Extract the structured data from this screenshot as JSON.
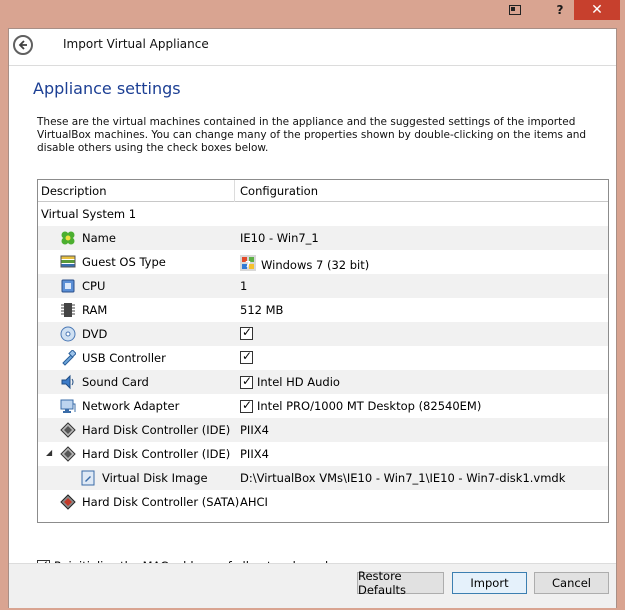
{
  "window": {
    "title": "Import Virtual Appliance",
    "help_glyph": "?",
    "close_glyph": "✕"
  },
  "page": {
    "heading": "Appliance settings",
    "description": "These are the virtual machines contained in the appliance and the suggested settings of the imported VirtualBox machines. You can change many of the properties shown by double-clicking on the items and disable others using the check boxes below."
  },
  "table": {
    "columns": [
      "Description",
      "Configuration"
    ],
    "system_label": "Virtual System 1",
    "rows": [
      {
        "label": "Name",
        "value": "IE10 - Win7_1",
        "icon": "name-icon",
        "checkbox": false
      },
      {
        "label": "Guest OS Type",
        "value": "Windows 7 (32 bit)",
        "icon": "os-type-icon",
        "checkbox": false
      },
      {
        "label": "CPU",
        "value": "1",
        "icon": "cpu-icon",
        "checkbox": false
      },
      {
        "label": "RAM",
        "value": "512 MB",
        "icon": "ram-icon",
        "checkbox": false
      },
      {
        "label": "DVD",
        "value": "",
        "icon": "dvd-icon",
        "checkbox": true
      },
      {
        "label": "USB Controller",
        "value": "",
        "icon": "usb-icon",
        "checkbox": true
      },
      {
        "label": "Sound Card",
        "value": "Intel HD Audio",
        "icon": "sound-card-icon",
        "checkbox": true
      },
      {
        "label": "Network Adapter",
        "value": "Intel PRO/1000 MT Desktop (82540EM)",
        "icon": "network-adapter-icon",
        "checkbox": true
      },
      {
        "label": "Hard Disk Controller (IDE)",
        "value": "PIIX4",
        "icon": "hdd-controller-icon",
        "checkbox": false
      },
      {
        "label": "Hard Disk Controller (IDE)",
        "value": "PIIX4",
        "icon": "hdd-controller-icon",
        "checkbox": false
      },
      {
        "label": "Virtual Disk Image",
        "value": "D:\\VirtualBox VMs\\IE10 - Win7_1\\IE10 - Win7-disk1.vmdk",
        "icon": "disk-image-icon",
        "checkbox": false
      },
      {
        "label": "Hard Disk Controller (SATA)",
        "value": "AHCI",
        "icon": "sata-controller-icon",
        "checkbox": false
      }
    ]
  },
  "options": {
    "reinit_mac_label": "Reinitialize the MAC address of all network cards",
    "reinit_mac_checked": true
  },
  "buttons": {
    "restore_defaults": "Restore Defaults",
    "import": "Import",
    "cancel": "Cancel"
  },
  "colors": {
    "heading": "#1c3f94",
    "window_chrome": "#d9a491",
    "close_button": "#c7402d",
    "default_button_border": "#3c7fb1"
  }
}
